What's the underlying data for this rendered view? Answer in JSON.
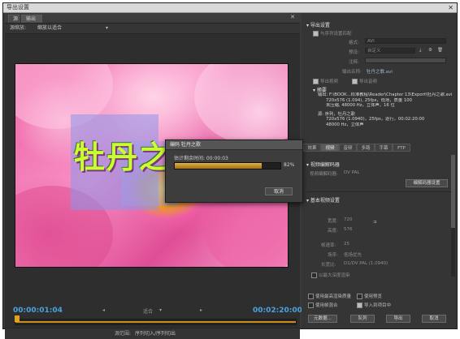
{
  "window": {
    "title": "导出设置",
    "close": "✕"
  },
  "left": {
    "tab_source": "源",
    "tab_output": "输出",
    "close": "✕",
    "source_range_label": "源缩放:",
    "source_range_value": "缩放以适合",
    "time_current": "00:00:01:04",
    "time_end": "00:02:20:00",
    "fit_label": "适合",
    "source_range_bottom_label": "源范围:",
    "source_range_bottom_value": "序列切入/序列切出",
    "title_text": "牡丹之歌",
    "timeline_progress": 1.0
  },
  "dialog": {
    "title": "编码 牡丹之歌",
    "estimate_label": "估计剩余时间: 00:00:03",
    "progress_percent": 82,
    "progress_text": "82%",
    "cancel_label": "取消"
  },
  "right": {
    "export_settings_title": "导出设置",
    "match_sequence": "与序列设置匹配",
    "format_label": "格式:",
    "format_value": "AVI",
    "preset_label": "预设:",
    "preset_value": "自定义",
    "comments_label": "注释:",
    "output_name_label": "输出名称:",
    "output_name_value": "牡丹之歌.avi",
    "export_video": "导出视频",
    "export_audio": "导出音频",
    "summary_title": "摘要",
    "summary_lines": [
      "输出: F:\\BOOK...标准教程\\Reader\\Chapter 13\\Export\\牡丹之歌.avi",
      "720x576 (1.094), 25fps，低场，质量 100",
      "未压缩, 48000 Hz，立体声，16 位",
      "源: 序列，牡丹之歌",
      "720x576 (1.0940)，25fps，逐行，00:02:20:00",
      "48000 Hz，立体声"
    ],
    "tabs": [
      "效果",
      "视频",
      "音频",
      "多路",
      "字幕",
      "FTP"
    ],
    "video_codec_section": "视频编解码器",
    "video_codec_label": "视频编解码器:",
    "video_codec_value": "DV PAL",
    "codec_settings_button": "编解码器设置",
    "basic_video_section": "基本视频设置",
    "width_label": "宽度:",
    "width_value": "720",
    "height_label": "高度:",
    "height_value": "576",
    "frame_rate_label": "帧速率:",
    "frame_rate_value": "25",
    "field_order_label": "场序:",
    "field_order_value": "低场优先",
    "aspect_label": "长宽比:",
    "aspect_value": "D1/DV PAL (1.0940)",
    "depth_label": "以最大深度渲染",
    "max_render_quality": "使用最高渲染质量",
    "use_previews": "使用预览",
    "use_frame_blending": "使用帧混合",
    "import_into_project": "导入到项目中",
    "metadata_button": "元数据...",
    "queue_button": "队列",
    "export_button": "导出",
    "cancel_button": "取消"
  }
}
